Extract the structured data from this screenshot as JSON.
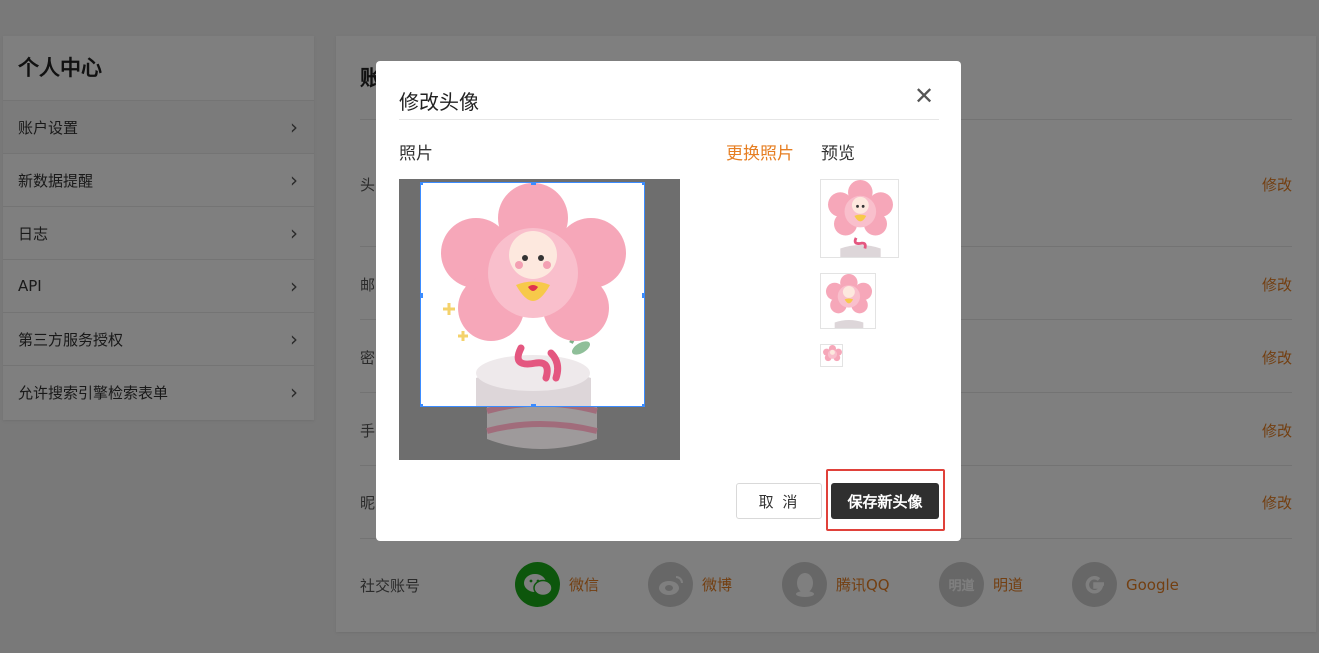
{
  "sidebar": {
    "title": "个人中心",
    "items": [
      {
        "label": "账户设置"
      },
      {
        "label": "新数据提醒"
      },
      {
        "label": "日志"
      },
      {
        "label": "API"
      },
      {
        "label": "第三方服务授权"
      },
      {
        "label": "允许搜索引擎检索表单"
      }
    ]
  },
  "main": {
    "title_partial": "账",
    "rows": [
      {
        "label_partial": "头",
        "action": "修改"
      },
      {
        "label_partial": "邮",
        "action": "修改"
      },
      {
        "label_partial": "密",
        "action": "修改"
      },
      {
        "label_partial": "手",
        "action": "修改"
      },
      {
        "label_partial": "昵",
        "action": "修改"
      }
    ],
    "social_label": "社交账号",
    "social": [
      {
        "name": "微信",
        "icon": "wechat-icon"
      },
      {
        "name": "微博",
        "icon": "weibo-icon"
      },
      {
        "name": "腾讯QQ",
        "icon": "qq-icon"
      },
      {
        "name": "明道",
        "icon": "mingdao-icon",
        "icon_text": "明道"
      },
      {
        "name": "Google",
        "icon": "google-icon"
      }
    ]
  },
  "modal": {
    "title": "修改头像",
    "photo_label": "照片",
    "change_photo": "更换照片",
    "preview_label": "预览",
    "cancel": "取 消",
    "save": "保存新头像"
  },
  "colors": {
    "accent": "#e67e22",
    "save_button": "#2f2f2f",
    "crop_border": "#3b8cff",
    "highlight": "#e0413a",
    "wechat": "#1aad19"
  }
}
